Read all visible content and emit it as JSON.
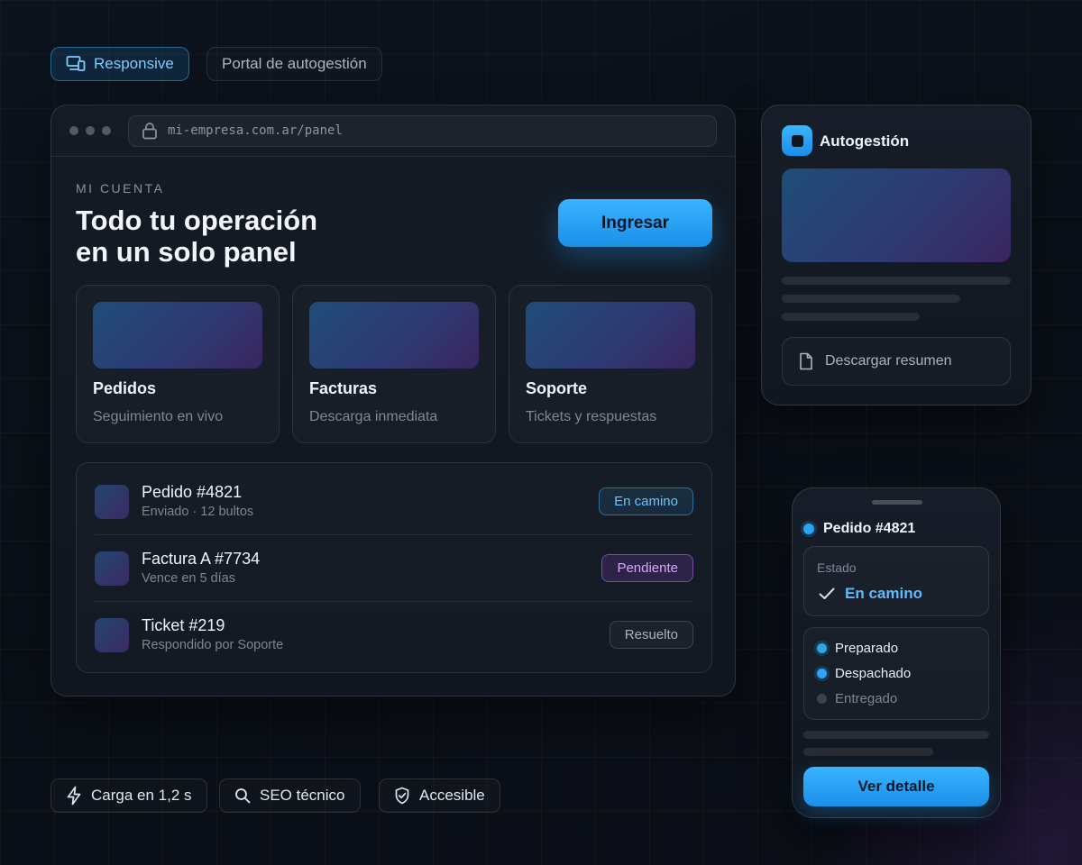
{
  "top_tags": {
    "responsive": "Responsive",
    "portal": "Portal de autogestión"
  },
  "browser": {
    "url": "mi-empresa.com.ar/panel",
    "eyebrow": "MI CUENTA",
    "headline_1": "Todo tu operación",
    "headline_2": "en un solo panel",
    "cta": "Ingresar",
    "cards": [
      {
        "title": "Pedidos",
        "subtitle": "Seguimiento en vivo"
      },
      {
        "title": "Facturas",
        "subtitle": "Descarga inmediata"
      },
      {
        "title": "Soporte",
        "subtitle": "Tickets y respuestas"
      }
    ],
    "rows": [
      {
        "title": "Pedido #4821",
        "subtitle": "Enviado · 12 bultos",
        "badge": "En camino",
        "badge_color": "#36a9f0"
      },
      {
        "title": "Factura A #7734",
        "subtitle": "Vence en 5 días",
        "badge": "Pendiente",
        "badge_color": "#b066f0"
      },
      {
        "title": "Ticket #219",
        "subtitle": "Respondido por Soporte",
        "badge": "Resuelto",
        "badge_color": "#9aa3b1"
      }
    ]
  },
  "side_panel": {
    "title": "Autogestión",
    "download": "Descargar resumen"
  },
  "phone": {
    "title": "Pedido #4821",
    "status_label": "Estado",
    "status_value": "En camino",
    "steps": [
      {
        "label": "Preparado",
        "done": true
      },
      {
        "label": "Despachado",
        "done": true
      },
      {
        "label": "Entregado",
        "done": false
      }
    ],
    "button": "Ver detalle"
  },
  "bottom_chips": {
    "speed": "Carga en 1,2 s",
    "seo": "SEO técnico",
    "accessible": "Accesible"
  },
  "colors": {
    "accent": "#2aa4f4",
    "purple": "#b066f0",
    "background": "#0b1018"
  }
}
